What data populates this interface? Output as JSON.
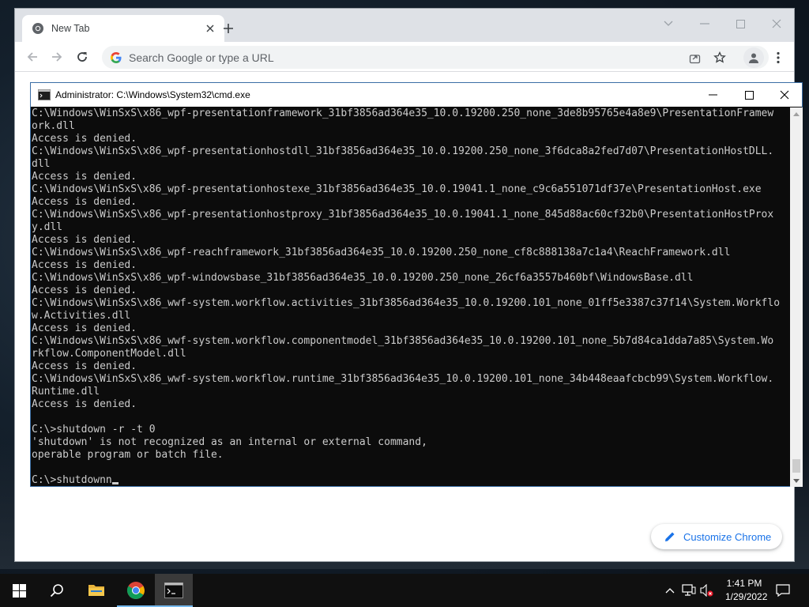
{
  "browser": {
    "tab_title": "New Tab",
    "omnibox_placeholder": "Search Google or type a URL",
    "customize_label": "Customize Chrome"
  },
  "cmd": {
    "title": "Administrator: C:\\Windows\\System32\\cmd.exe",
    "lines": [
      "C:\\Windows\\WinSxS\\x86_wpf-presentationframework_31bf3856ad364e35_10.0.19200.250_none_3de8b95765e4a8e9\\PresentationFramew",
      "ork.dll",
      "Access is denied.",
      "C:\\Windows\\WinSxS\\x86_wpf-presentationhostdll_31bf3856ad364e35_10.0.19200.250_none_3f6dca8a2fed7d07\\PresentationHostDLL.",
      "dll",
      "Access is denied.",
      "C:\\Windows\\WinSxS\\x86_wpf-presentationhostexe_31bf3856ad364e35_10.0.19041.1_none_c9c6a551071df37e\\PresentationHost.exe",
      "Access is denied.",
      "C:\\Windows\\WinSxS\\x86_wpf-presentationhostproxy_31bf3856ad364e35_10.0.19041.1_none_845d88ac60cf32b0\\PresentationHostProx",
      "y.dll",
      "Access is denied.",
      "C:\\Windows\\WinSxS\\x86_wpf-reachframework_31bf3856ad364e35_10.0.19200.250_none_cf8c888138a7c1a4\\ReachFramework.dll",
      "Access is denied.",
      "C:\\Windows\\WinSxS\\x86_wpf-windowsbase_31bf3856ad364e35_10.0.19200.250_none_26cf6a3557b460bf\\WindowsBase.dll",
      "Access is denied.",
      "C:\\Windows\\WinSxS\\x86_wwf-system.workflow.activities_31bf3856ad364e35_10.0.19200.101_none_01ff5e3387c37f14\\System.Workflo",
      "w.Activities.dll",
      "Access is denied.",
      "C:\\Windows\\WinSxS\\x86_wwf-system.workflow.componentmodel_31bf3856ad364e35_10.0.19200.101_none_5b7d84ca1dda7a85\\System.Wo",
      "rkflow.ComponentModel.dll",
      "Access is denied.",
      "C:\\Windows\\WinSxS\\x86_wwf-system.workflow.runtime_31bf3856ad364e35_10.0.19200.101_none_34b448eaafcbcb99\\System.Workflow.",
      "Runtime.dll",
      "Access is denied.",
      "",
      "C:\\>shutdown -r -t 0",
      "'shutdown' is not recognized as an internal or external command,",
      "operable program or batch file.",
      ""
    ],
    "prompt_line": "C:\\>shutdownn"
  },
  "taskbar": {
    "time": "1:41 PM",
    "date": "1/29/2022"
  },
  "icons": {
    "tab_favicon": "chrome-icon",
    "new_tab": "plus-icon",
    "back": "arrow-left-icon",
    "forward": "arrow-right-icon",
    "reload": "reload-icon",
    "share": "share-icon",
    "bookmark": "star-icon",
    "profile": "person-icon",
    "menu": "kebab-menu-icon",
    "start": "windows-logo-icon",
    "search": "search-icon",
    "explorer": "folder-icon",
    "chrome": "chrome-icon",
    "cmd": "terminal-icon"
  },
  "colors": {
    "console_bg": "#0c0c0c",
    "console_text": "#cccccc",
    "accent_blue": "#1a73e8",
    "taskbar": "#101010"
  }
}
